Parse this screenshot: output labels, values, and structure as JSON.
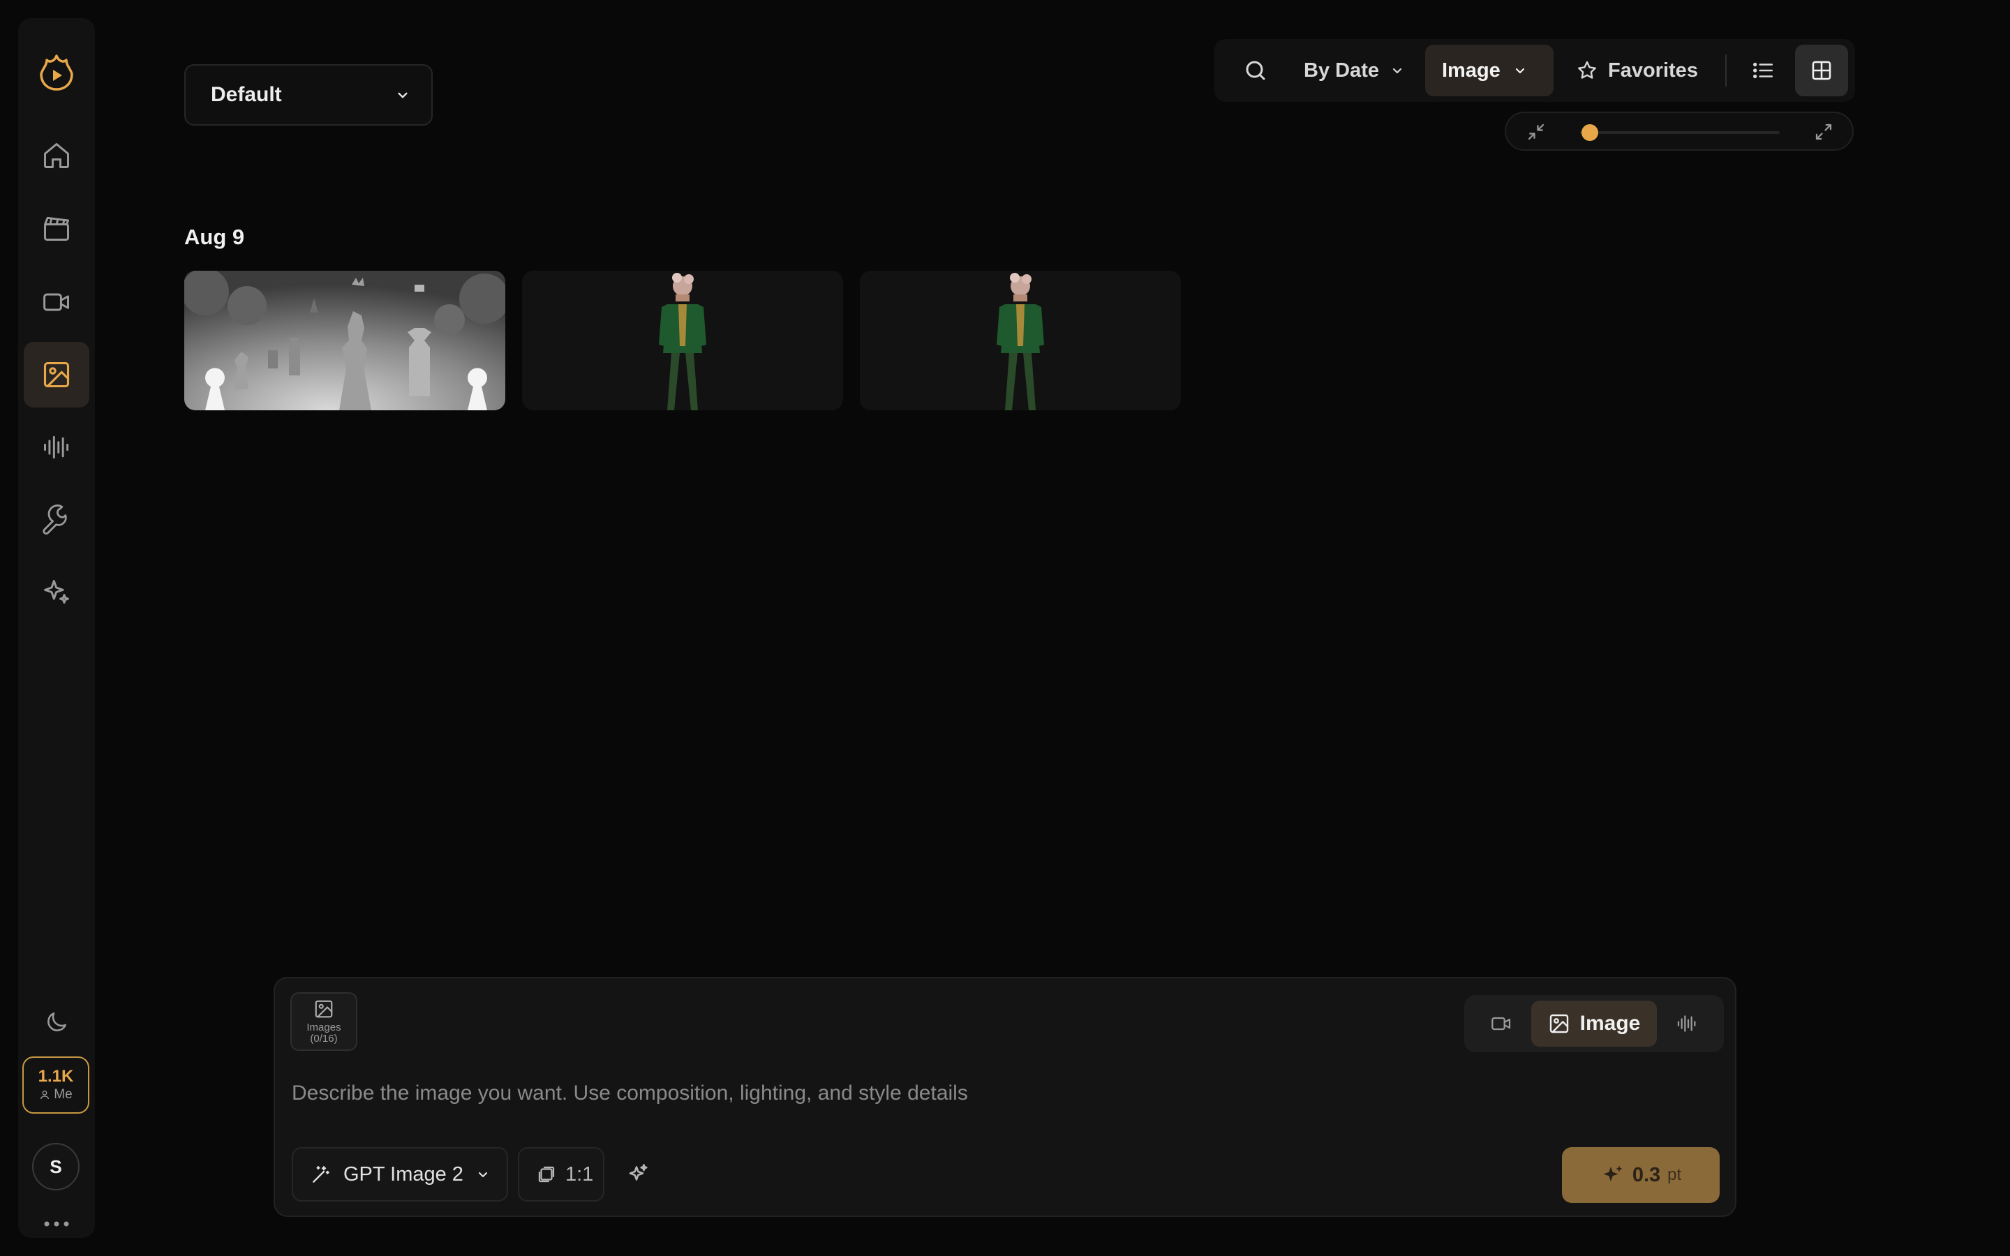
{
  "sidebar": {
    "logo_icon": "flame-play-logo",
    "items": [
      {
        "icon": "home-icon",
        "active": false
      },
      {
        "icon": "clapperboard-icon",
        "active": false
      },
      {
        "icon": "video-camera-icon",
        "active": false
      },
      {
        "icon": "image-icon",
        "active": true
      },
      {
        "icon": "audio-wave-icon",
        "active": false
      },
      {
        "icon": "wrench-icon",
        "active": false
      },
      {
        "icon": "sparkles-icon",
        "active": false
      }
    ],
    "theme_icon": "moon-icon",
    "credits": {
      "amount": "1.1K",
      "owner": "Me"
    },
    "avatar_initial": "S",
    "more_icon": "more-dots-icon"
  },
  "project_select": {
    "value": "Default"
  },
  "toolbar": {
    "sort_label": "By Date",
    "type_label": "Image",
    "favorites_label": "Favorites",
    "view_mode": "grid"
  },
  "zoom": {
    "level": 0.05
  },
  "gallery": {
    "groups": [
      {
        "date": "Aug 9",
        "items": [
          {
            "kind": "depth-map",
            "alt": "chess scene depth map"
          },
          {
            "kind": "character",
            "alt": "character in green coat"
          },
          {
            "kind": "character",
            "alt": "character in green coat"
          }
        ]
      }
    ]
  },
  "composer": {
    "attach_label": "Images",
    "attach_count": "(0/16)",
    "modes": [
      "video",
      "Image",
      "audio"
    ],
    "active_mode": "Image",
    "placeholder": "Describe the image you want. Use composition, lighting, and style details",
    "model_label": "GPT Image 2",
    "aspect_ratio": "1:1",
    "cost_value": "0.3",
    "cost_unit": "pt"
  },
  "colors": {
    "accent": "#e8a84a",
    "background": "#080808",
    "panel": "#141414",
    "generate_button": "#8a6a38"
  }
}
